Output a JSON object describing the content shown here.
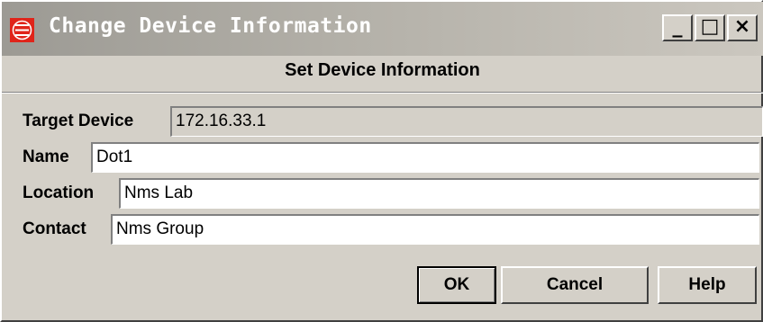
{
  "window": {
    "title": "Change Device Information",
    "icon": "app-logo-icon",
    "controls": {
      "minimize": "_",
      "maximize": "□",
      "close": "×"
    }
  },
  "header": {
    "title": "Set Device Information"
  },
  "form": {
    "target_device": {
      "label": "Target Device",
      "value": "172.16.33.1"
    },
    "name": {
      "label": "Name",
      "value": "Dot1"
    },
    "location": {
      "label": "Location",
      "value": "Nms Lab"
    },
    "contact": {
      "label": "Contact",
      "value": "Nms Group"
    }
  },
  "buttons": {
    "ok": "OK",
    "cancel": "Cancel",
    "help": "Help"
  },
  "colors": {
    "titlebar": "#9c9a94",
    "icon_red": "#e0241a",
    "dialog_bg": "#d4d0c8"
  }
}
